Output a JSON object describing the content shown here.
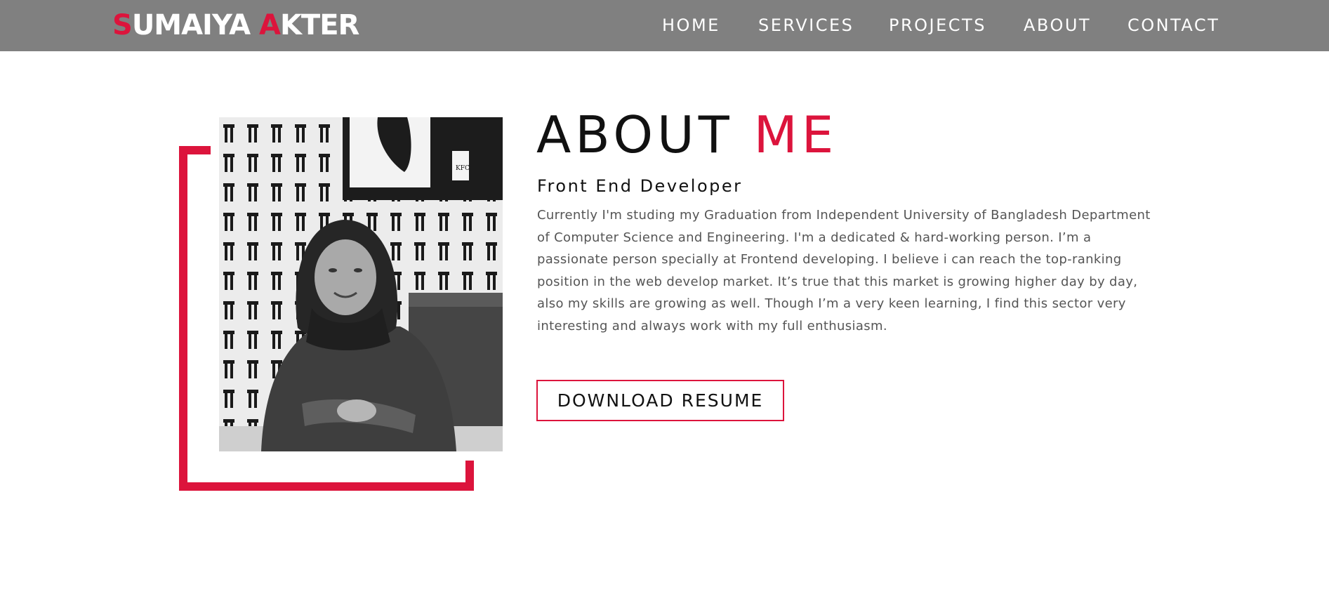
{
  "brand": {
    "initial_first": "S",
    "rest_first": "UMAIYA ",
    "initial_last": "A",
    "rest_last": "KTER",
    "accent_color": "#dc143c"
  },
  "nav": {
    "items": [
      {
        "label": "HOME"
      },
      {
        "label": "SERVICES"
      },
      {
        "label": "PROJECTS"
      },
      {
        "label": "ABOUT"
      },
      {
        "label": "CONTACT"
      }
    ]
  },
  "about": {
    "title_main": "ABOUT ",
    "title_accent": "ME",
    "subtitle": "Front End Developer",
    "description": "Currently I'm studing my Graduation from Independent University of Bangladesh Department of Computer Science and Engineering. I'm a dedicated & hard-working person. I’m a passionate person specially at Frontend developing. I believe i can reach the top-ranking position in the web develop market. It’s true that this market is growing higher day by day, also my skills are growing as well. Though I’m a very keen learning, I find this sector very interesting and always work with my full enthusiasm.",
    "resume_button": "DOWNLOAD RESUME",
    "photo_sign_text": "KFC"
  },
  "colors": {
    "navbar_bg": "#808080",
    "accent": "#dc143c",
    "text_dark": "#111111",
    "text_body": "#555555"
  }
}
